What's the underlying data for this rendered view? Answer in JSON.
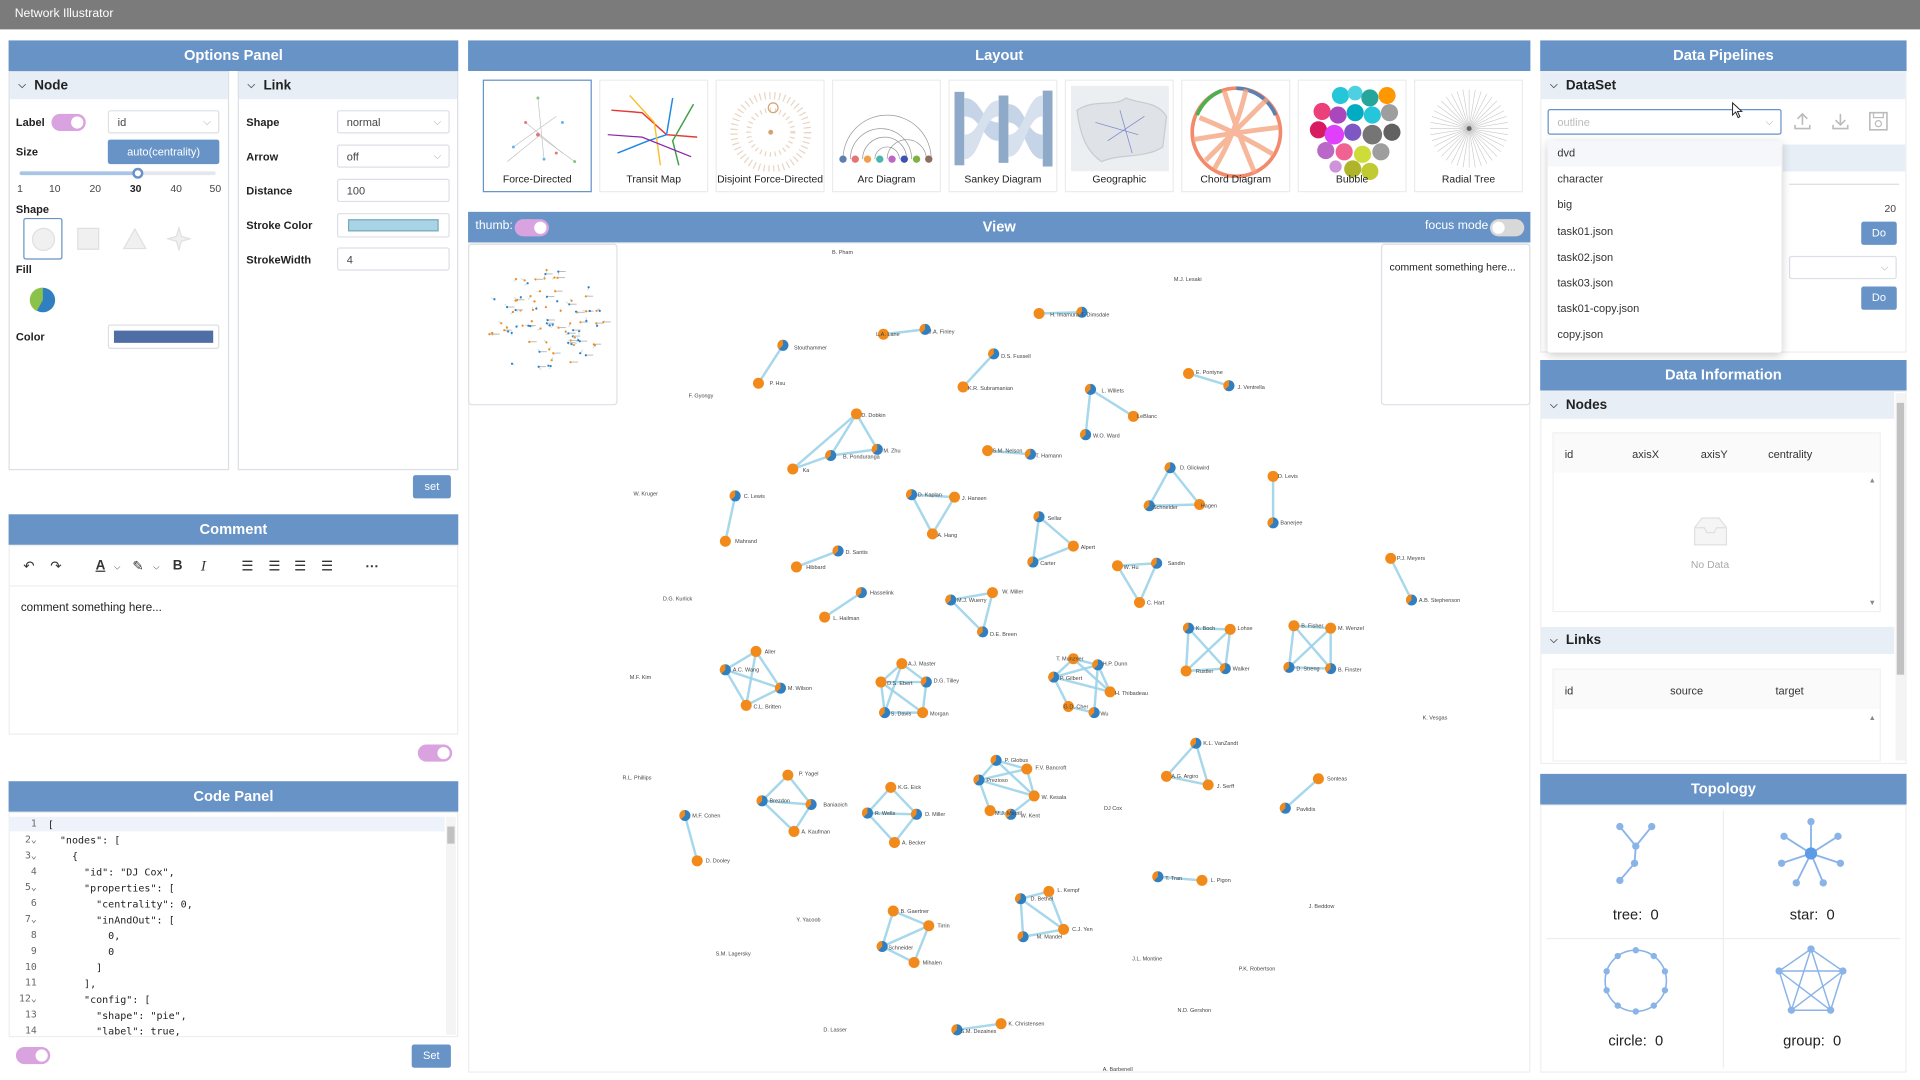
{
  "app": {
    "title": "Network Illustrator"
  },
  "options_panel": {
    "title": "Options Panel",
    "node": {
      "title": "Node",
      "label_label": "Label",
      "label_value": "id",
      "size_label": "Size",
      "size_button": "auto(centrality)",
      "size_ticks": [
        "1",
        "10",
        "20",
        "30",
        "40",
        "50"
      ],
      "size_value_tick": "30",
      "shape_label": "Shape",
      "fill_label": "Fill",
      "color_label": "Color",
      "color_value": "#4f6ea6"
    },
    "link": {
      "title": "Link",
      "shape_label": "Shape",
      "shape_value": "normal",
      "arrow_label": "Arrow",
      "arrow_value": "off",
      "distance_label": "Distance",
      "distance_value": "100",
      "stroke_color_label": "Stroke Color",
      "stroke_color_value": "#a8d4e6",
      "stroke_width_label": "StrokeWidth",
      "stroke_width_value": "4"
    },
    "set_button": "set"
  },
  "comment_panel": {
    "title": "Comment",
    "text": "comment something here...",
    "toolbar_icons": [
      "undo-icon",
      "redo-icon",
      "font-color-icon",
      "highlight-icon",
      "bold-icon",
      "italic-icon",
      "align-left-icon",
      "align-center-icon",
      "align-right-icon",
      "justify-icon",
      "more-icon"
    ]
  },
  "code_panel": {
    "title": "Code Panel",
    "lines": [
      "[",
      "  \"nodes\": [",
      "    {",
      "      \"id\": \"DJ Cox\",",
      "      \"properties\": [",
      "        \"centrality\": 0,",
      "        \"inAndOut\": [",
      "          0,",
      "          0",
      "        ]",
      "      ],",
      "      \"config\": [",
      "        \"shape\": \"pie\",",
      "        \"label\": true,"
    ],
    "set_button": "Set"
  },
  "layout_panel": {
    "title": "Layout",
    "options": [
      "Force-Directed",
      "Transit Map",
      "Disjoint Force-Directed",
      "Arc Diagram",
      "Sankey Diagram",
      "Geographic",
      "Chord Diagram",
      "Bubble",
      "Radial Tree"
    ],
    "selected": "Force-Directed"
  },
  "view_panel": {
    "title": "View",
    "thumb_label": "thumb:",
    "focus_label": "focus mode",
    "comment_placeholder": "comment something here...",
    "node_colors": {
      "blue": "#2f7fc1",
      "orange": "#f28a1b",
      "link": "#9cd3e8"
    },
    "labels": [
      {
        "t": "B. Pham"
      },
      {
        "t": "M.J. Lesaki"
      },
      {
        "t": "H. Imamura"
      },
      {
        "t": "T. Dimsdale"
      },
      {
        "t": "L.A. Lane"
      },
      {
        "t": "J.A. Finley"
      },
      {
        "t": "Stouthammer"
      },
      {
        "t": "P. Hsu"
      },
      {
        "t": "F. Gyongy"
      },
      {
        "t": "D.S. Fussell"
      },
      {
        "t": "K.R. Subramanian"
      },
      {
        "t": "E. Pontyne"
      },
      {
        "t": "J. Ventrella"
      },
      {
        "t": "L. Willets"
      },
      {
        "t": "LeBlanc"
      },
      {
        "t": "W.O. Ward"
      },
      {
        "t": "D. Dobkin"
      },
      {
        "t": "M. Zhu"
      },
      {
        "t": "B. Ponduranga"
      },
      {
        "t": "Ka"
      },
      {
        "t": "S.M. Nelson"
      },
      {
        "t": "T. Hamann"
      },
      {
        "t": "D. Glickwird"
      },
      {
        "t": "D. Levis"
      },
      {
        "t": "W. Kruger"
      },
      {
        "t": "C. Lewis"
      },
      {
        "t": "Mahrand"
      },
      {
        "t": "D. Kaplan"
      },
      {
        "t": "J. Hansen"
      },
      {
        "t": "A. Hang"
      },
      {
        "t": "Schneider"
      },
      {
        "t": "Hagen"
      },
      {
        "t": "Banerjee"
      },
      {
        "t": "Sellar"
      },
      {
        "t": "Alpert"
      },
      {
        "t": "Carter"
      },
      {
        "t": "D. Santis"
      },
      {
        "t": "Hibbard"
      },
      {
        "t": "W. Hu"
      },
      {
        "t": "Sandin"
      },
      {
        "t": "C. Hart"
      },
      {
        "t": "P.J. Meyers"
      },
      {
        "t": "A.B. Stephenson"
      },
      {
        "t": "D.G. Kurlick"
      },
      {
        "t": "Hasselink"
      },
      {
        "t": "L. Hailman"
      },
      {
        "t": "W. Miller"
      },
      {
        "t": "M.J. Wuerry"
      },
      {
        "t": "D.E. Breen"
      },
      {
        "t": "K. Boch"
      },
      {
        "t": "Lohse"
      },
      {
        "t": "Rustler"
      },
      {
        "t": "Walker"
      },
      {
        "t": "B. Fisher"
      },
      {
        "t": "M. Wenzel"
      },
      {
        "t": "D. Streng"
      },
      {
        "t": "B. Finster"
      },
      {
        "t": "Aller"
      },
      {
        "t": "A.C. Wang"
      },
      {
        "t": "M. Wilson"
      },
      {
        "t": "C.L. Britten"
      },
      {
        "t": "A.J. Master"
      },
      {
        "t": "M.F. Kim"
      },
      {
        "t": "D.S. Ebert"
      },
      {
        "t": "D.G. Tilley"
      },
      {
        "t": "S. Davis"
      },
      {
        "t": "Morgan"
      },
      {
        "t": "T. Munzner"
      },
      {
        "t": "H.P. Dunn"
      },
      {
        "t": "P. Gilbert"
      },
      {
        "t": "H. Thibadeau"
      },
      {
        "t": "G.D. Cher"
      },
      {
        "t": "Wu"
      },
      {
        "t": "K. Vesgas"
      },
      {
        "t": "K.L. VanZandt"
      },
      {
        "t": "A.G. Argiro"
      },
      {
        "t": "J. Serff"
      },
      {
        "t": "Sonteas"
      },
      {
        "t": "Pavlidis"
      },
      {
        "t": "R.L. Phillips"
      },
      {
        "t": "P. Yagel"
      },
      {
        "t": "Brezdon"
      },
      {
        "t": "Baniaoich"
      },
      {
        "t": "A. Kaufman"
      },
      {
        "t": "K.G. Eick"
      },
      {
        "t": "R. Wells"
      },
      {
        "t": "D. Miller"
      },
      {
        "t": "A. Becker"
      },
      {
        "t": "P. Globus"
      },
      {
        "t": "Prezioso"
      },
      {
        "t": "F.V. Bancroft"
      },
      {
        "t": "W. Kesala"
      },
      {
        "t": "M.J. Merrill"
      },
      {
        "t": "W. Kent"
      },
      {
        "t": "DJ Cox"
      },
      {
        "t": "M.F. Cohen"
      },
      {
        "t": "D. Dooley"
      },
      {
        "t": "T. Tran"
      },
      {
        "t": "L. Pigon"
      },
      {
        "t": "J. Beddow"
      },
      {
        "t": "Y. Yacoob"
      },
      {
        "t": "S.M. Lagersky"
      },
      {
        "t": "B. Gaertner"
      },
      {
        "t": "Tirrin"
      },
      {
        "t": "Schneider"
      },
      {
        "t": "Mihalen"
      },
      {
        "t": "L. Kempf"
      },
      {
        "t": "D. Bethel"
      },
      {
        "t": "C.J. Yen"
      },
      {
        "t": "M. Mandel"
      },
      {
        "t": "J.L. Montine"
      },
      {
        "t": "P.K. Robertson"
      },
      {
        "t": "N.D. Gershon"
      },
      {
        "t": "D. Lasser"
      },
      {
        "t": "S.M. Dezaines"
      },
      {
        "t": "K. Christensen"
      },
      {
        "t": "A. Barbenell"
      }
    ]
  },
  "data_pipelines": {
    "title": "Data Pipelines",
    "dataset_title": "DataSet",
    "select_placeholder": "outline",
    "dropdown_options": [
      "dvd",
      "character",
      "big",
      "task01.json",
      "task02.json",
      "task03.json",
      "task01-copy.json",
      "copy.json"
    ],
    "number_value": "20",
    "do_button": "Do"
  },
  "data_info": {
    "title": "Data Information",
    "nodes_title": "Nodes",
    "node_columns": [
      "id",
      "axisX",
      "axisY",
      "centrality"
    ],
    "no_data": "No Data",
    "links_title": "Links",
    "link_columns": [
      "id",
      "source",
      "target"
    ]
  },
  "topology": {
    "title": "Topology",
    "items": [
      {
        "label": "tree:",
        "value": "0"
      },
      {
        "label": "star:",
        "value": "0"
      },
      {
        "label": "circle:",
        "value": "0"
      },
      {
        "label": "group:",
        "value": "0"
      }
    ]
  }
}
